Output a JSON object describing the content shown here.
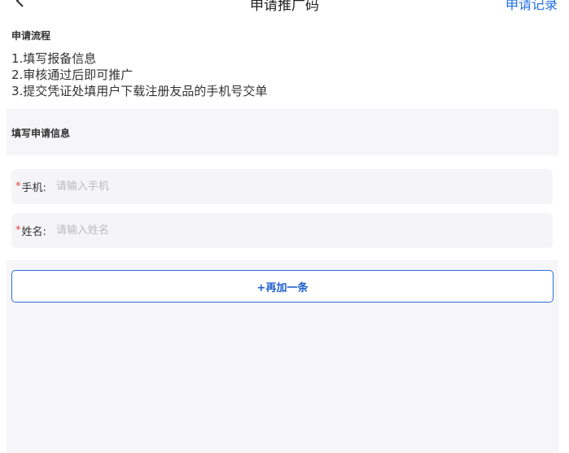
{
  "nav": {
    "title": "申请推广码",
    "right_link": "申请记录"
  },
  "process": {
    "heading": "申请流程",
    "steps": [
      "1.填写报备信息",
      "2.审核通过后即可推广",
      "3.提交凭证处填用户下载注册友品的手机号交单"
    ]
  },
  "form": {
    "heading": "填写申请信息",
    "required_mark": "*",
    "phone": {
      "label": "手机:",
      "placeholder": "请输入手机"
    },
    "name": {
      "label": "姓名:",
      "placeholder": "请输入姓名"
    },
    "add_label": "+再加一条"
  }
}
